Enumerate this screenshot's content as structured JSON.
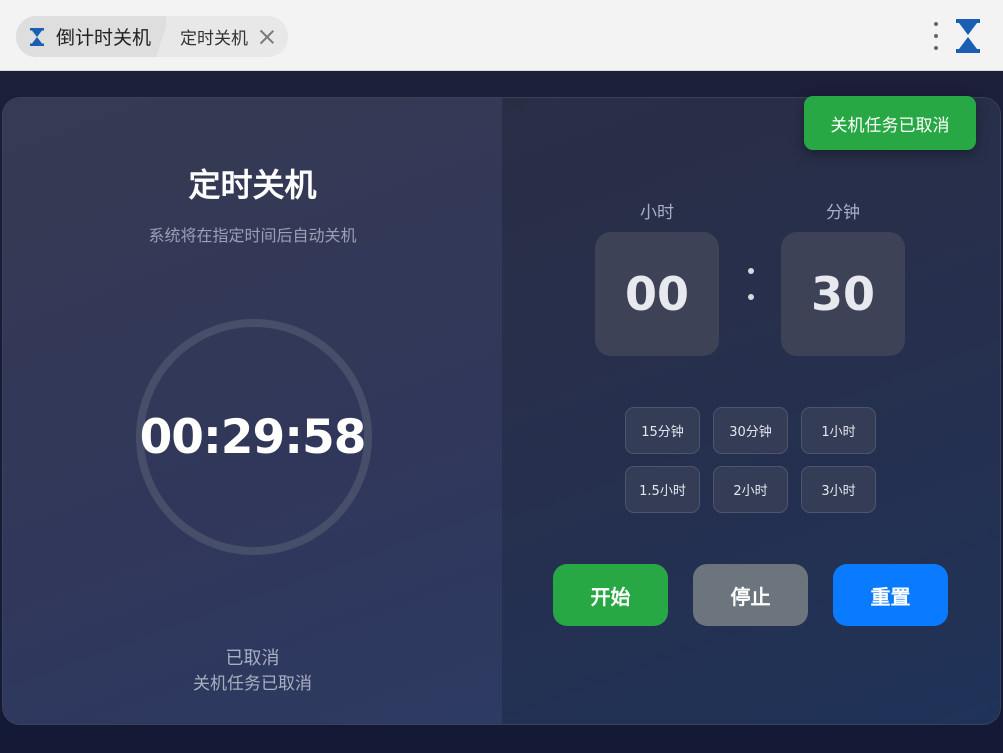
{
  "browser": {
    "tab_title": "倒计时关机",
    "sub_tab_title": "定时关机"
  },
  "timer": {
    "title": "定时关机",
    "subtitle": "系统将在指定时间后自动关机",
    "countdown": "00:29:58",
    "status": "已取消",
    "status_detail": "关机任务已取消"
  },
  "time_picker": {
    "hours_label": "小时",
    "minutes_label": "分钟",
    "hours_value": "00",
    "minutes_value": "30"
  },
  "presets": [
    "15分钟",
    "30分钟",
    "1小时",
    "1.5小时",
    "2小时",
    "3小时"
  ],
  "actions": {
    "start": "开始",
    "stop": "停止",
    "reset": "重置"
  },
  "toast": {
    "message": "关机任务已取消"
  },
  "colors": {
    "start": "#28a745",
    "stop": "#6c757d",
    "reset": "#0a7bff",
    "toast": "#28a745"
  }
}
